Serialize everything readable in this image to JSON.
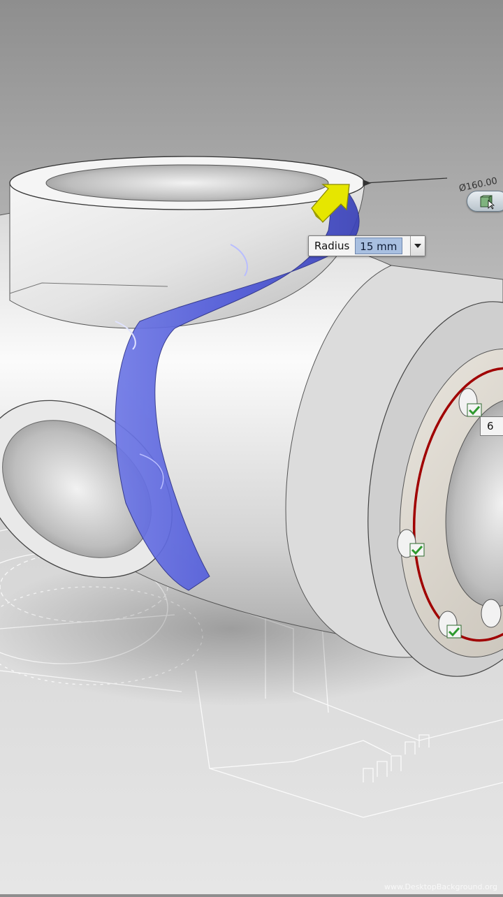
{
  "dimension_label": "Ø160.00",
  "radius_control": {
    "label": "Radius",
    "value": "15 mm"
  },
  "instance_count": {
    "value": "6"
  },
  "colors": {
    "fillet_highlight": "#4e58d8",
    "bolt_circle": "#a00000",
    "drag_arrow": "#e6e600",
    "check_mark": "#2e9a2e"
  },
  "icons": {
    "drag_handle": "arrow-handle-icon",
    "tool": "view-cube-icon",
    "checks": "checkmark-icon"
  },
  "watermark": "www.DesktopBackground.org"
}
